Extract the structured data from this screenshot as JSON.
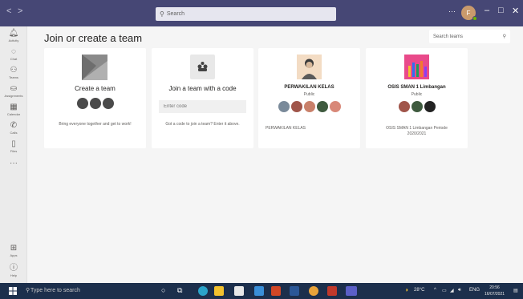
{
  "titlebar": {
    "back_icon": "chevron-left-icon",
    "forward_icon": "chevron-right-icon",
    "search_placeholder": "Search",
    "more_label": "···",
    "avatar_initial": "F",
    "minimize": "–",
    "maximize": "□",
    "close": "✕"
  },
  "rail": {
    "items": [
      {
        "label": "Activity",
        "icon": "bell-icon"
      },
      {
        "label": "Chat",
        "icon": "chat-icon"
      },
      {
        "label": "Teams",
        "icon": "teams-icon"
      },
      {
        "label": "Assignments",
        "icon": "assignments-icon"
      },
      {
        "label": "Calendar",
        "icon": "calendar-icon"
      },
      {
        "label": "Calls",
        "icon": "phone-icon"
      },
      {
        "label": "Files",
        "icon": "file-icon"
      }
    ],
    "more": "···",
    "apps_label": "Apps",
    "help_label": "Help"
  },
  "main": {
    "title": "Join or create a team",
    "search_placeholder": "Search teams"
  },
  "cards": {
    "create": {
      "title": "Create a team",
      "description": "Bring everyone together and get to work!"
    },
    "join": {
      "title": "Join a team with a code",
      "input_placeholder": "Enter code",
      "description": "Got a code to join a team? Enter it above."
    },
    "team1": {
      "name": "PERWAKILAN KELAS",
      "visibility": "Public",
      "description": "PERWAKILAN KELAS"
    },
    "team2": {
      "name": "OSIS SMAN 1 Limbangan",
      "visibility": "Public",
      "description": "OSIS SMAN 1 Limbangan Periode 2020/2021"
    }
  },
  "taskbar": {
    "search_placeholder": "Type here to search",
    "weather": "28°C",
    "language": "ENG",
    "time": "20:56",
    "date": "16/07/2021"
  },
  "colors": {
    "titlebar": "#464775",
    "taskbar": "#1c2f4c",
    "rail": "#ebebeb",
    "accent": "#6264a7"
  }
}
